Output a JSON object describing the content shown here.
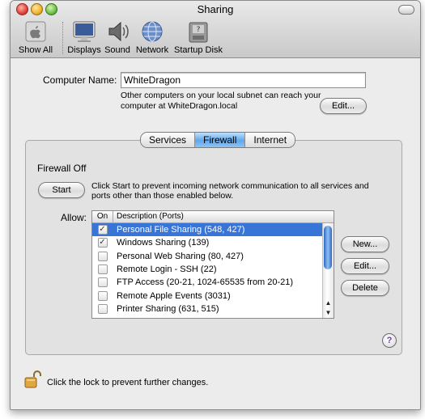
{
  "window": {
    "title": "Sharing"
  },
  "toolbar": {
    "items": [
      {
        "label": "Show All",
        "icon": "apple-icon"
      },
      {
        "label": "Displays",
        "icon": "display-icon"
      },
      {
        "label": "Sound",
        "icon": "speaker-icon"
      },
      {
        "label": "Network",
        "icon": "globe-icon"
      },
      {
        "label": "Startup Disk",
        "icon": "disk-icon"
      }
    ]
  },
  "computer_name": {
    "label": "Computer Name:",
    "value": "WhiteDragon",
    "info_line1": "Other computers on your local subnet can reach your",
    "info_line2": "computer at WhiteDragon.local",
    "edit_label": "Edit..."
  },
  "tabs": [
    {
      "label": "Services",
      "active": false
    },
    {
      "label": "Firewall",
      "active": true
    },
    {
      "label": "Internet",
      "active": false
    }
  ],
  "firewall": {
    "status": "Firewall Off",
    "start_label": "Start",
    "description_line1": "Click Start to prevent incoming network communication to all services and",
    "description_line2": "ports other than those enabled below.",
    "allow_label": "Allow:",
    "columns": {
      "on": "On",
      "description": "Description (Ports)"
    },
    "rows": [
      {
        "on": true,
        "description": "Personal File Sharing (548, 427)",
        "selected": true
      },
      {
        "on": true,
        "description": "Windows Sharing (139)",
        "selected": false
      },
      {
        "on": false,
        "description": "Personal Web Sharing (80, 427)",
        "selected": false
      },
      {
        "on": false,
        "description": "Remote Login - SSH (22)",
        "selected": false
      },
      {
        "on": false,
        "description": "FTP Access (20-21, 1024-65535 from 20-21)",
        "selected": false
      },
      {
        "on": false,
        "description": "Remote Apple Events (3031)",
        "selected": false
      },
      {
        "on": false,
        "description": "Printer Sharing (631, 515)",
        "selected": false
      }
    ],
    "buttons": {
      "new": "New...",
      "edit": "Edit...",
      "delete": "Delete"
    }
  },
  "help": {
    "glyph": "?"
  },
  "lock": {
    "text": "Click the lock to prevent further changes."
  },
  "colors": {
    "selection": "#3875d7",
    "tab_active": "#5fa7ec",
    "accent": "#2d67c1"
  }
}
